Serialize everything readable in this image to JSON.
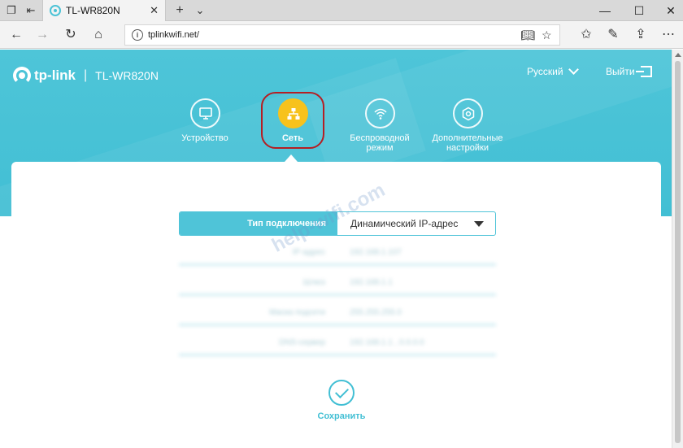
{
  "browser": {
    "tab_title": "TL-WR820N",
    "url": "tplinkwifi.net/",
    "icons": [
      "tab-list-icon",
      "back-tab-icon",
      "new-tab-icon",
      "tab-chevron-icon",
      "back-icon",
      "forward-icon",
      "refresh-icon",
      "home-icon",
      "info-icon",
      "reading-view-icon",
      "favorite-star-icon",
      "favorites-list-icon",
      "pen-icon",
      "share-icon",
      "more-icon"
    ]
  },
  "router": {
    "brand": "tp-link",
    "model": "TL-WR820N",
    "language": "Русский",
    "logout": "Выйти",
    "nav": {
      "device": "Устройство",
      "network": "Сеть",
      "wireless": "Беспроводной режим",
      "advanced": "Дополнительные настройки"
    },
    "connection_type_label": "Тип подключения",
    "connection_type_value": "Динамический IP-адрес",
    "blurred_rows": [
      {
        "label": "IP-адрес",
        "value": "192.168.1.107"
      },
      {
        "label": "Шлюз",
        "value": "192.168.1.1"
      },
      {
        "label": "Маска подсети",
        "value": "255.255.255.0"
      },
      {
        "label": "DNS-сервер",
        "value": "192.168.1.1 , 0.0.0.0"
      }
    ],
    "watermark": "help-wifi.com",
    "save_label": "Сохранить"
  },
  "colors": {
    "accent": "#42bfd4",
    "active_nav": "#f7c21c",
    "highlight": "#b51e23"
  }
}
